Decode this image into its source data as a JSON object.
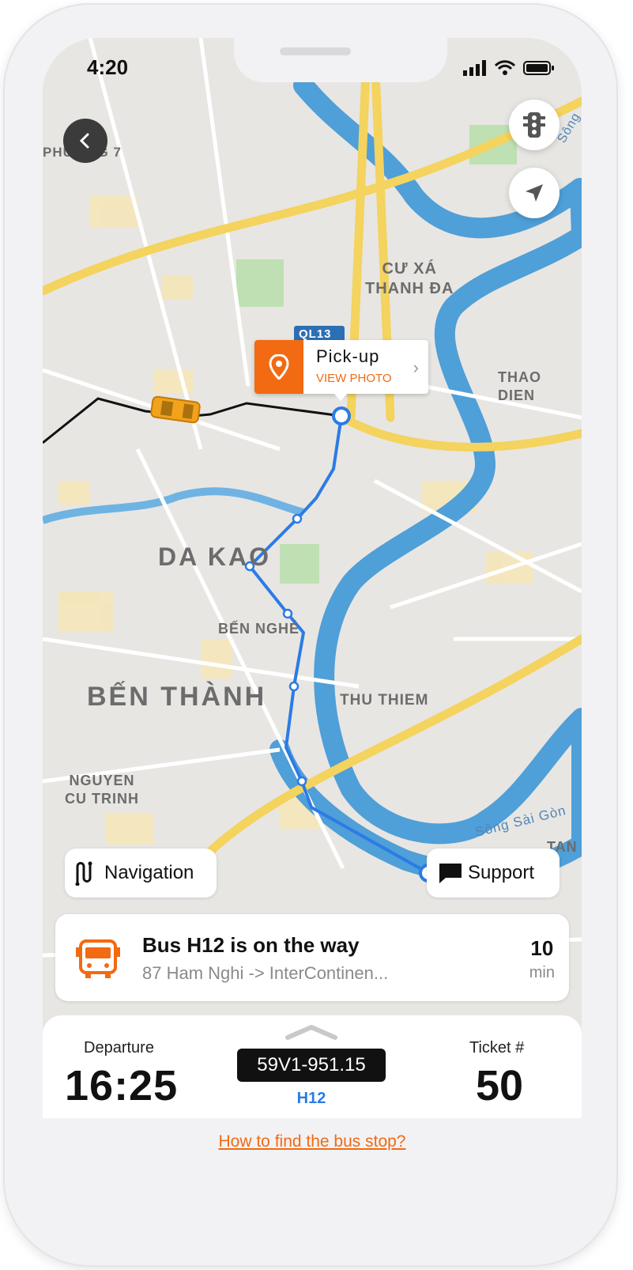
{
  "status_bar": {
    "time": "4:20"
  },
  "map": {
    "labels": {
      "phuong7": "PHƯỜNG 7",
      "cu_xa": "CƯ XÁ\nTHANH ĐA",
      "ql13": "QL13",
      "thao_dien": "THAO DIEN",
      "da_kao": "DA KAO",
      "ben_nghe": "BẾN NGHÉ",
      "ben_thanh": "BẾN THÀNH",
      "thu_thiem": "THU THIEM",
      "nguyen_cu_trinh": "NGUYEN\nCU TRINH",
      "song_sai_gon": "Sông Sài Gòn",
      "song_side": "Sông",
      "tan_partial": "TAN\nD"
    },
    "pickup": {
      "title": "Pick-up",
      "subtitle": "VIEW PHOTO"
    },
    "icons": {
      "back": "chevron-left-icon",
      "traffic": "traffic-light-icon",
      "locate": "navigation-arrow-icon",
      "pickup": "map-pin-icon",
      "vehicle": "taxi-icon"
    }
  },
  "actions": {
    "navigation_label": "Navigation",
    "support_label": "Support"
  },
  "trip_card": {
    "title": "Bus H12 is on the way",
    "route": "87 Ham Nghi  -> InterContinen...",
    "eta_value": "10",
    "eta_unit": "min"
  },
  "trip_details": {
    "departure_label": "Departure",
    "departure_time": "16:25",
    "plate": "59V1-951.15",
    "route_code": "H12",
    "ticket_label": "Ticket #",
    "ticket_number": "50",
    "help_link": "How to find the bus stop?"
  },
  "colors": {
    "accent": "#f26a12",
    "route_line": "#2c7be5",
    "river": "#4f9fd8",
    "highway": "#f4d35e"
  }
}
